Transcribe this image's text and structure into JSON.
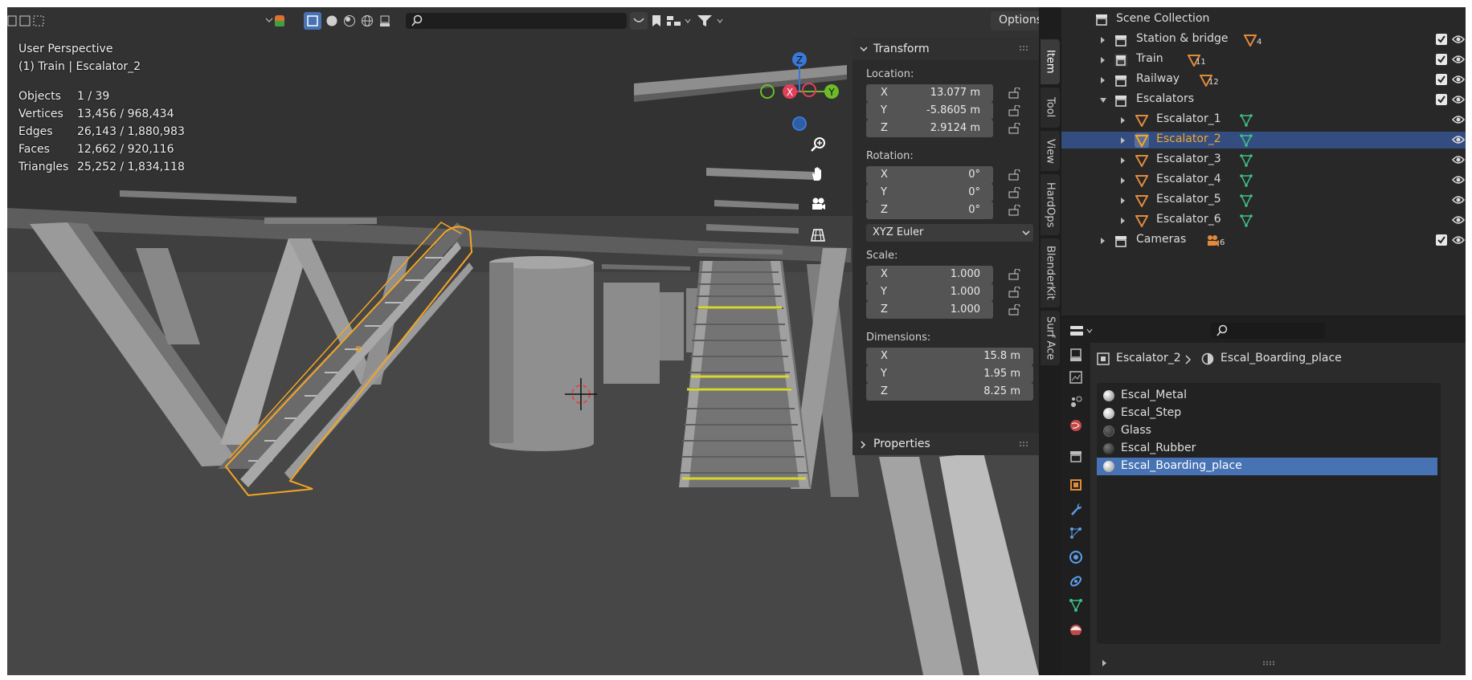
{
  "viewport": {
    "perspective": "User Perspective",
    "context": "(1) Train | Escalator_2",
    "options_label": "Options",
    "stats": [
      {
        "label": "Objects",
        "value": "1 / 39"
      },
      {
        "label": "Vertices",
        "value": "13,456 / 968,434"
      },
      {
        "label": "Edges",
        "value": "26,143 / 1,880,983"
      },
      {
        "label": "Faces",
        "value": "12,662 / 920,116"
      },
      {
        "label": "Triangles",
        "value": "25,252 / 1,834,118"
      }
    ],
    "gizmo": {
      "z": "Z",
      "x": "X",
      "y": "Y"
    }
  },
  "sidebar": {
    "tabs": [
      "Item",
      "Tool",
      "View",
      "HardOps",
      "BlenderKit",
      "Surf Ace"
    ],
    "transform": {
      "title": "Transform",
      "location_label": "Location:",
      "location": {
        "x": "13.077 m",
        "y": "-5.8605 m",
        "z": "2.9124 m"
      },
      "rotation_label": "Rotation:",
      "rotation": {
        "x": "0°",
        "y": "0°",
        "z": "0°"
      },
      "rotation_mode": "XYZ Euler",
      "scale_label": "Scale:",
      "scale": {
        "x": "1.000",
        "y": "1.000",
        "z": "1.000"
      },
      "dimensions_label": "Dimensions:",
      "dimensions": {
        "x": "15.8 m",
        "y": "1.95 m",
        "z": "8.25 m"
      },
      "axes": {
        "x": "X",
        "y": "Y",
        "z": "Z"
      }
    },
    "properties_title": "Properties"
  },
  "outliner": {
    "root": "Scene Collection",
    "rows": [
      {
        "label": "Station & bridge",
        "badge": "4"
      },
      {
        "label": "Train",
        "badge": "11"
      },
      {
        "label": "Railway",
        "badge": "12"
      },
      {
        "label": "Escalators"
      },
      {
        "label": "Escalator_1"
      },
      {
        "label": "Escalator_2"
      },
      {
        "label": "Escalator_3"
      },
      {
        "label": "Escalator_4"
      },
      {
        "label": "Escalator_5"
      },
      {
        "label": "Escalator_6"
      },
      {
        "label": "Cameras",
        "badge": "6"
      }
    ]
  },
  "properties": {
    "breadcrumb_object": "Escalator_2",
    "breadcrumb_material": "Escal_Boarding_place",
    "materials": [
      "Escal_Metal",
      "Escal_Step",
      "Glass",
      "Escal_Rubber",
      "Escal_Boarding_place"
    ]
  },
  "colors": {
    "selection": "#4772b3",
    "outliner_selection": "#334d80",
    "active_object": "#f5a623",
    "object_icon": "#e08a3c",
    "mesh_icon": "#3fbf86"
  }
}
